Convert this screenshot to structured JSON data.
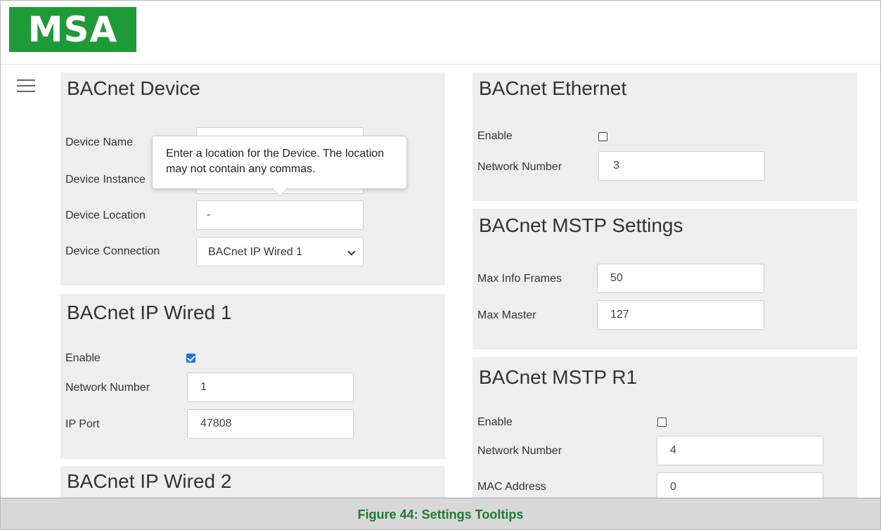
{
  "brand": {
    "logo_text": "MSA",
    "logo_color": "#1f9a38"
  },
  "menu": {
    "icon": "hamburger-menu-icon"
  },
  "bacnet_device": {
    "title": "BACnet Device",
    "fields": {
      "device_name": {
        "label": "Device Name",
        "value": ""
      },
      "device_instance": {
        "label": "Device Instance",
        "value": ""
      },
      "device_location": {
        "label": "Device Location",
        "value": "-"
      },
      "device_connection": {
        "label": "Device Connection",
        "value": "BACnet IP Wired 1"
      }
    }
  },
  "tooltip": {
    "text": "Enter a location for the Device. The location may not contain any commas."
  },
  "bacnet_ip_wired_1": {
    "title": "BACnet IP Wired 1",
    "enable_label": "Enable",
    "enabled": true,
    "network_number_label": "Network Number",
    "network_number": "1",
    "ip_port_label": "IP Port",
    "ip_port": "47808"
  },
  "bacnet_ip_wired_2": {
    "title": "BACnet IP Wired 2"
  },
  "bacnet_ethernet": {
    "title": "BACnet Ethernet",
    "enable_label": "Enable",
    "enabled": false,
    "network_number_label": "Network Number",
    "network_number": "3"
  },
  "bacnet_mstp_settings": {
    "title": "BACnet MSTP Settings",
    "max_info_frames_label": "Max Info Frames",
    "max_info_frames": "50",
    "max_master_label": "Max Master",
    "max_master": "127"
  },
  "bacnet_mstp_r1": {
    "title": "BACnet MSTP R1",
    "enable_label": "Enable",
    "enabled": false,
    "network_number_label": "Network Number",
    "network_number": "4",
    "mac_address_label": "MAC Address",
    "mac_address": "0"
  },
  "caption": "Figure 44: Settings Tooltips"
}
